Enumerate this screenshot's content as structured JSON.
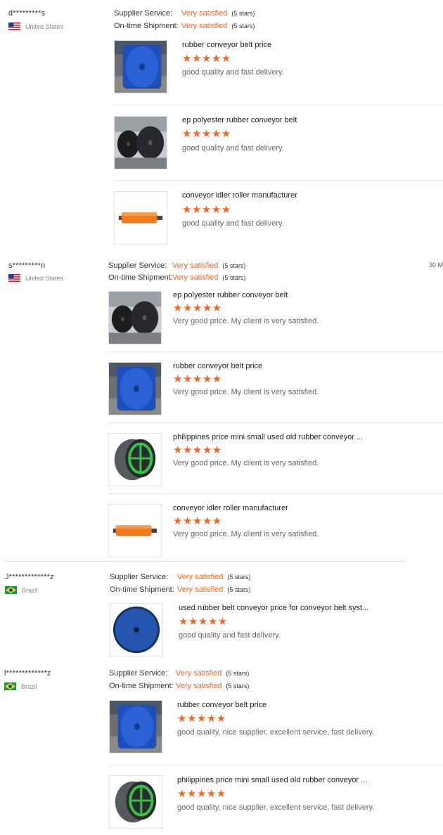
{
  "labels": {
    "supplier_service": "Supplier Service:",
    "on_time_shipment": "On-time Shipment:",
    "very_satisfied": "Very satisfied",
    "five_stars": "(5 stars)",
    "stars_glyph": "★★★★★"
  },
  "reviews": [
    {
      "buyer": "d*********s",
      "country": "United States",
      "products": [
        {
          "title": "rubber conveyor belt price",
          "comment": "good quality and fast delivery.",
          "image": "blue-belt-roll"
        },
        {
          "title": "ep polyester rubber conveyor belt",
          "comment": "good quality and fast delivery.",
          "image": "black-belt-rolls"
        },
        {
          "title": "conveyor idler roller manufacturer",
          "comment": "good quality and fast delivery.",
          "image": "orange-roller"
        }
      ]
    },
    {
      "buyer": "s*********n",
      "country": "United States",
      "time": "30 M",
      "products": [
        {
          "title": "ep polyester rubber conveyor belt",
          "comment": "Very good price. My client is very satisfied.",
          "image": "black-belt-rolls"
        },
        {
          "title": "rubber conveyor belt price",
          "comment": "Very good price. My client is very satisfied.",
          "image": "blue-belt-roll"
        },
        {
          "title": "philippines price mini small used old rubber conveyor ...",
          "comment": "Very good price. My client is very satisfied.",
          "image": "green-reel-belt"
        },
        {
          "title": "conveyor idler roller manufacturer",
          "comment": "Very good price. My client is very satisfied.",
          "image": "orange-roller"
        }
      ]
    },
    {
      "buyer": "J*************z",
      "country": "Brazil",
      "products": [
        {
          "title": "used rubber belt conveyor price for conveyor belt syst...",
          "comment": "good quality and fast delivery.",
          "image": "blue-belt-roll-round"
        }
      ]
    },
    {
      "buyer": "l*************z",
      "country": "Brazil",
      "products": [
        {
          "title": "rubber conveyor belt price",
          "comment": "good quality, nice supplier, excellent service, fast delivery.",
          "image": "blue-belt-roll"
        },
        {
          "title": "philippines price mini small used old rubber conveyor ...",
          "comment": "good quality, nice supplier, excellent service, fast delivery.",
          "image": "green-reel-belt"
        }
      ]
    }
  ],
  "colors": {
    "accent": "#f0672a",
    "divider": "#e6e6e6"
  }
}
